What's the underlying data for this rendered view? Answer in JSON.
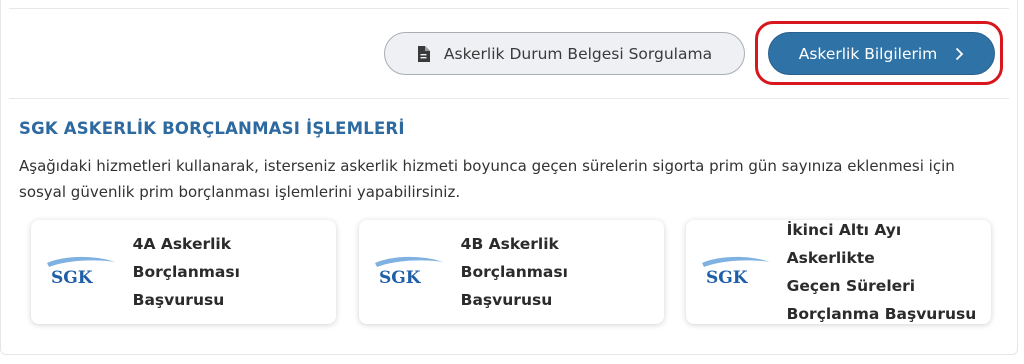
{
  "actions": {
    "military_status_button": "Askerlik Durum Belgesi Sorgulama",
    "military_info_button": "Askerlik Bilgilerim"
  },
  "section": {
    "title": "SGK ASKERLİK BORÇLANMASI İŞLEMLERİ",
    "description_line1": "Aşağıdaki hizmetleri kullanarak, isterseniz askerlik hizmeti boyunca geçen sürelerin sigorta prim gün sayınıza eklenmesi için",
    "description_line2": "sosyal güvenlik prim borçlanması işlemlerini yapabilirsiniz."
  },
  "cards": [
    {
      "logo_text": "SGK",
      "line1": "4A Askerlik",
      "line2": "Borçlanması Başvurusu"
    },
    {
      "logo_text": "SGK",
      "line1": "4B Askerlik",
      "line2": "Borçlanması Başvurusu"
    },
    {
      "logo_text": "SGK",
      "line1": "İkinci Altı Ayı Askerlikte",
      "line2": "Geçen Süreleri",
      "line3": "Borçlanma Başvurusu"
    }
  ],
  "colors": {
    "primary_button": "#2f73a6",
    "title_blue": "#2e6aa0",
    "highlight_red": "#d8161d",
    "sgk_blue": "#1f5fa8"
  },
  "icons": {
    "document": "document-icon",
    "chevron": "chevron-right-icon",
    "sgk_logo": "sgk-logo"
  }
}
